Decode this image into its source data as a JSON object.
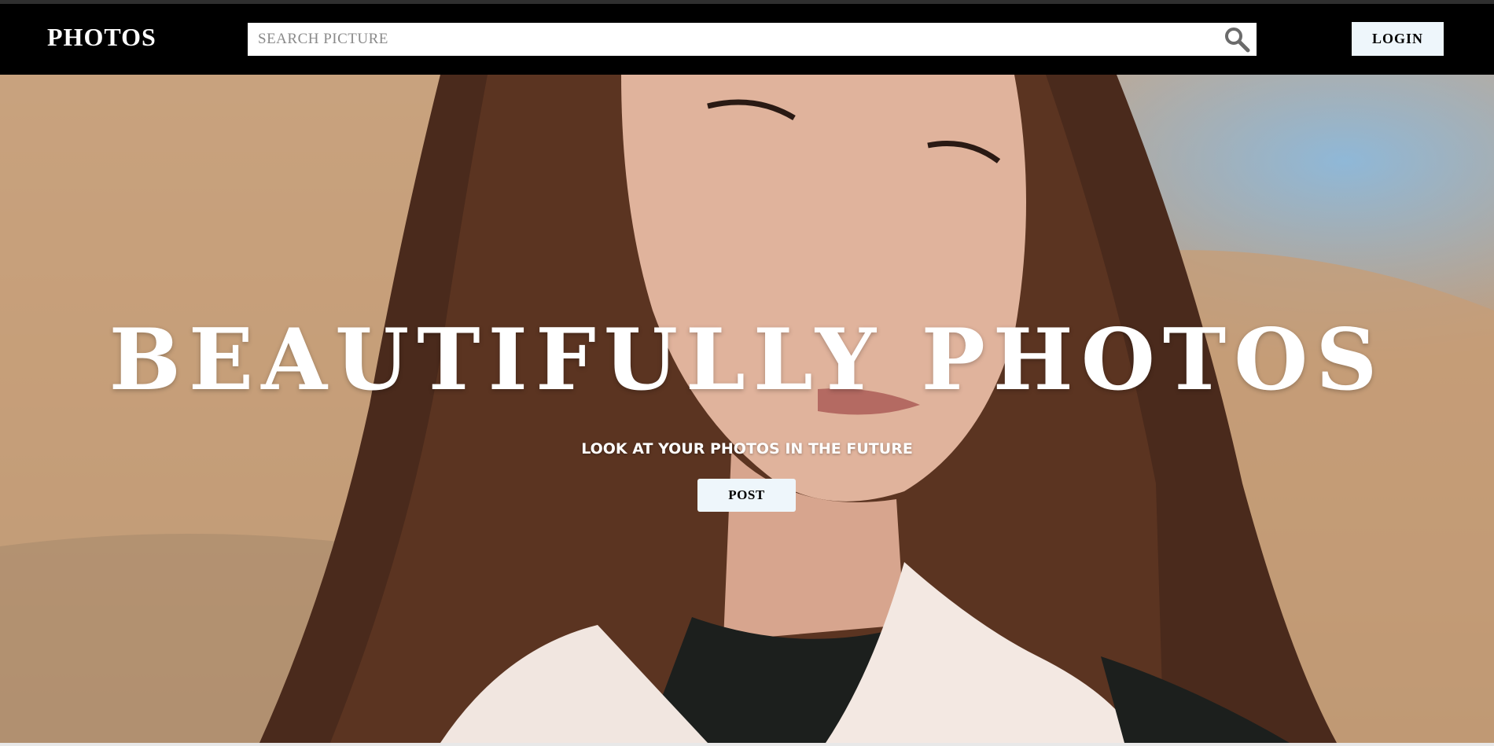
{
  "navbar": {
    "brand": "PHOTOS",
    "search": {
      "placeholder": "SEARCH PICTURE",
      "value": ""
    },
    "login_label": "LOGIN"
  },
  "hero": {
    "title": "BEAUTIFULLY PHOTOS",
    "subtitle": "LOOK AT YOUR PHOTOS IN THE FUTURE",
    "post_label": "POST"
  },
  "colors": {
    "navbar_bg": "#000000",
    "button_bg": "#eef6fb",
    "text_light": "#ffffff"
  },
  "icons": {
    "search": "search-icon"
  }
}
